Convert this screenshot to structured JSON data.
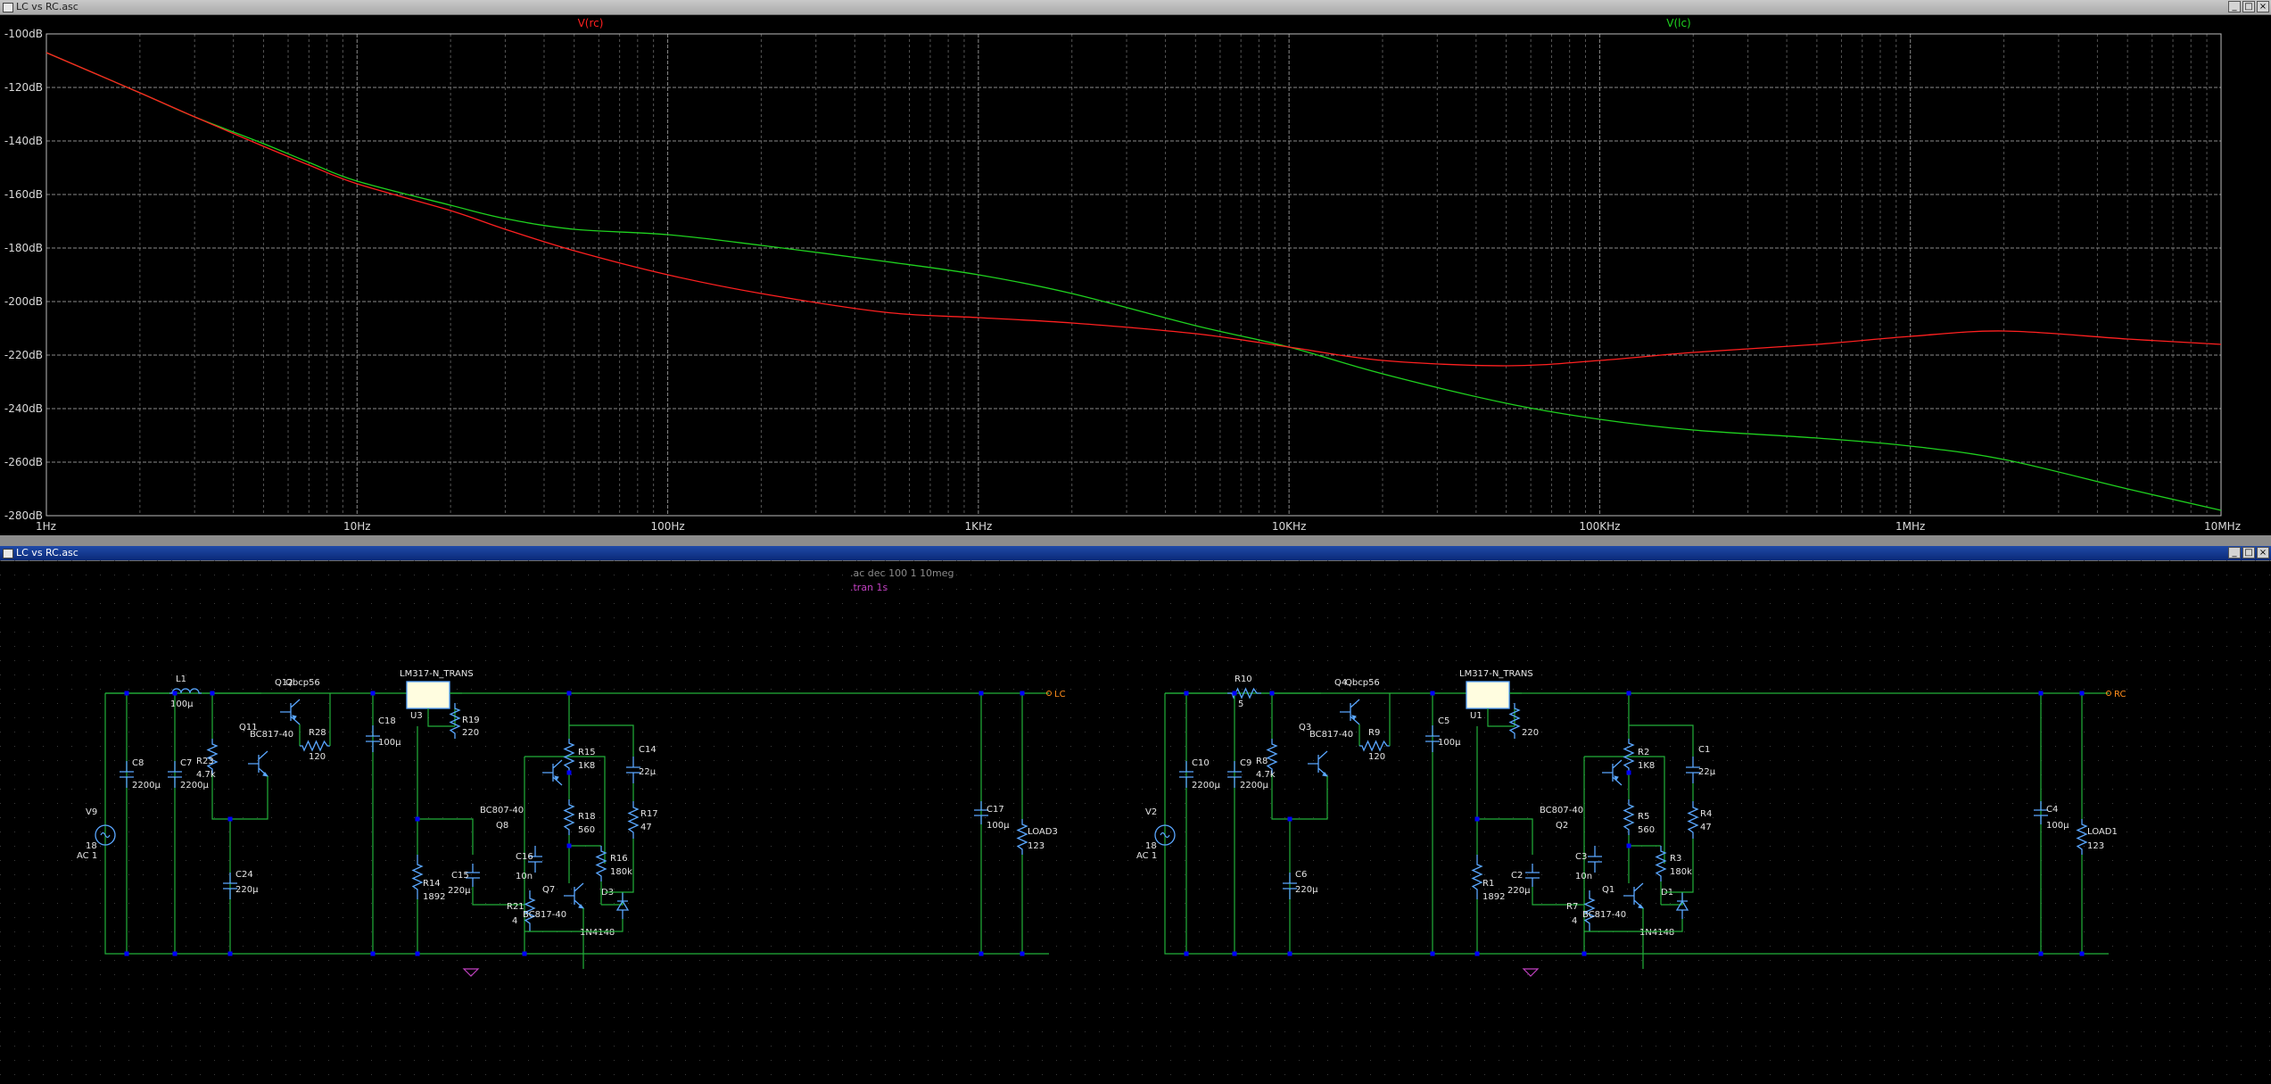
{
  "plot_window": {
    "title": "LC vs RC.asc",
    "buttons": [
      "_",
      "□",
      "×"
    ],
    "chart_data": {
      "type": "line",
      "x_scale": "log",
      "xlim": [
        1,
        10000000
      ],
      "ylim": [
        -280,
        -100
      ],
      "x_ticks": [
        "1Hz",
        "10Hz",
        "100Hz",
        "1KHz",
        "10KHz",
        "100KHz",
        "1MHz",
        "10MHz"
      ],
      "y_ticks": [
        "-100dB",
        "-120dB",
        "-140dB",
        "-160dB",
        "-180dB",
        "-200dB",
        "-220dB",
        "-240dB",
        "-260dB",
        "-280dB"
      ],
      "grid": true,
      "series": [
        {
          "name": "V(rc)",
          "color": "#ff2020",
          "x": [
            1,
            2,
            3,
            5,
            7,
            10,
            20,
            30,
            50,
            100,
            200,
            500,
            1000,
            2000,
            5000,
            10000,
            20000,
            50000,
            100000,
            200000,
            500000,
            1000000,
            2000000,
            5000000,
            10000000
          ],
          "y": [
            -107,
            -122,
            -131,
            -142,
            -149,
            -156,
            -166,
            -173,
            -181,
            -190,
            -197,
            -204,
            -206,
            -208,
            -212,
            -217,
            -222,
            -224,
            -222,
            -219,
            -216,
            -213,
            -211,
            -214,
            -216
          ]
        },
        {
          "name": "V(lc)",
          "color": "#1fd11f",
          "x": [
            1,
            2,
            3,
            5,
            7,
            10,
            20,
            30,
            50,
            100,
            200,
            500,
            1000,
            2000,
            5000,
            10000,
            20000,
            50000,
            100000,
            200000,
            500000,
            1000000,
            2000000,
            5000000,
            10000000
          ],
          "y": [
            -107,
            -122,
            -131,
            -141,
            -148,
            -155,
            -164,
            -169,
            -173,
            -175,
            -179,
            -185,
            -190,
            -197,
            -209,
            -217,
            -227,
            -238,
            -244,
            -248,
            -251,
            -254,
            -259,
            -270,
            -278
          ]
        }
      ]
    }
  },
  "schematic_window": {
    "title": "LC vs RC.asc",
    "buttons": [
      "_",
      "□",
      "×"
    ],
    "directives": [
      ".ac dec 100 1 10meg",
      ".tran 1s"
    ],
    "labels": {
      "lc": {
        "L1": "L1",
        "L1v": "100µ",
        "C8": "C8",
        "C8v": "2200µ",
        "C7": "C7",
        "C7v": "2200µ",
        "R23": "R23",
        "R23v": "4.7k",
        "Q11": "Q11",
        "Q11m": "BC817-40",
        "Q12": "Q12",
        "Q12m": "Qbcp56",
        "R28": "R28",
        "R28v": "120",
        "C24": "C24",
        "C24v": "220µ",
        "C18": "C18",
        "C18v": "100µ",
        "U3": "U3",
        "reg": "LM317-N_TRANS",
        "R19": "R19",
        "R19v": "220",
        "R14": "R14",
        "R14v": "1892",
        "C15": "C15",
        "C15v": "220µ",
        "C16": "C16",
        "C16v": "10n",
        "R21": "R21",
        "R21v": "4",
        "Q8": "Q8",
        "Q8m": "BC807-40",
        "Q7": "Q7",
        "Q7m": "BC817-40",
        "R15": "R15",
        "R15v": "1K8",
        "R18": "R18",
        "R18v": "560",
        "R16": "R16",
        "R16v": "180k",
        "D3": "D3",
        "D3m": "1N4148",
        "C14": "C14",
        "C14v": "22µ",
        "R17": "R17",
        "R17v": "47",
        "C17": "C17",
        "C17v": "100µ",
        "LOAD": "LOAD3",
        "LOADv": "123",
        "V": "V9",
        "Vv1": "18",
        "Vv2": "AC 1",
        "net": "LC"
      },
      "rc": {
        "R10": "R10",
        "R10v": "5",
        "C10": "C10",
        "C10v": "2200µ",
        "C9": "C9",
        "C9v": "2200µ",
        "R8": "R8",
        "R8v": "4.7k",
        "Q3": "Q3",
        "Q3m": "BC817-40",
        "Q4": "Q4",
        "Q4m": "Qbcp56",
        "R9": "R9",
        "R9v": "120",
        "C6": "C6",
        "C6v": "220µ",
        "C5": "C5",
        "C5v": "100µ",
        "U1": "U1",
        "reg": "LM317-N_TRANS",
        "R6": "R6",
        "R6v": "220",
        "R1": "R1",
        "R1v": "1892",
        "C2": "C2",
        "C2v": "220µ",
        "C3": "C3",
        "C3v": "10n",
        "R7": "R7",
        "R7v": "4",
        "Q2": "Q2",
        "Q2m": "BC807-40",
        "Q1": "Q1",
        "Q1m": "BC817-40",
        "R2": "R2",
        "R2v": "1K8",
        "R5": "R5",
        "R5v": "560",
        "R3": "R3",
        "R3v": "180k",
        "D1": "D1",
        "D1m": "1N4148",
        "C1": "C1",
        "C1v": "22µ",
        "R4": "R4",
        "R4v": "47",
        "C4": "C4",
        "C4v": "100µ",
        "LOAD": "LOAD1",
        "LOADv": "123",
        "V": "V2",
        "Vv1": "18",
        "Vv2": "AC 1",
        "net": "RC"
      }
    }
  }
}
